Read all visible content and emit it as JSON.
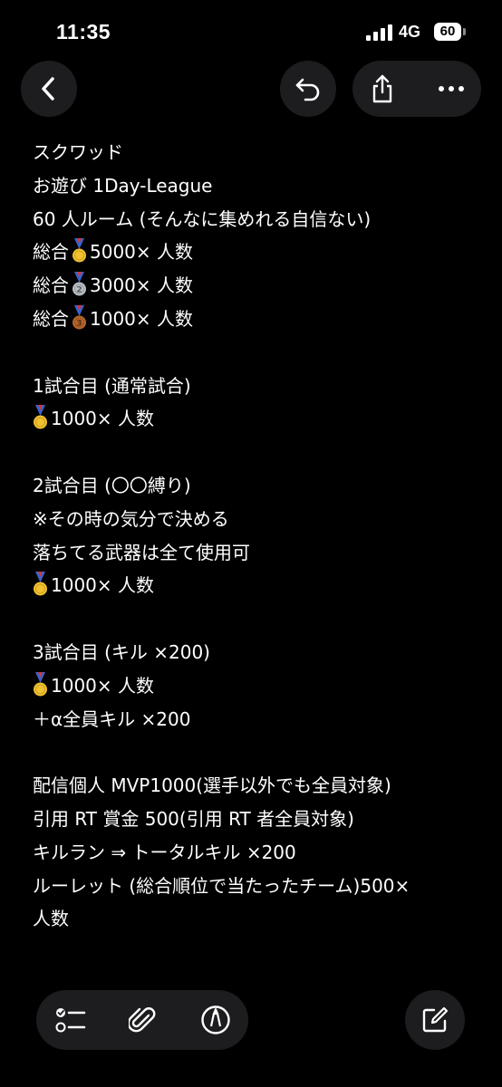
{
  "status_bar": {
    "time": "11:35",
    "network": "4G",
    "battery": "60"
  },
  "nav": {
    "back_icon": "chevron-left-icon",
    "undo_icon": "undo-icon",
    "share_icon": "share-icon",
    "more_icon": "ellipsis-icon"
  },
  "note": {
    "lines": [
      {
        "text": "スクワッド"
      },
      {
        "text": "お遊び 1Day-League"
      },
      {
        "text": "60 人ルーム (そんなに集めれる自信ない)"
      },
      {
        "text": "5000× 人数",
        "prefix": "総合",
        "medal": "gold-medal-icon"
      },
      {
        "text": "3000× 人数",
        "prefix": "総合",
        "medal": "silver-medal-icon"
      },
      {
        "text": "1000× 人数",
        "prefix": "総合",
        "medal": "bronze-medal-icon"
      },
      {
        "text": ""
      },
      {
        "text": "1試合目 (通常試合)"
      },
      {
        "text": "1000× 人数",
        "medal": "gold-medal-icon"
      },
      {
        "text": ""
      },
      {
        "text": "2試合目 (〇〇縛り)"
      },
      {
        "text": "※その時の気分で決める"
      },
      {
        "text": "落ちてる武器は全て使用可"
      },
      {
        "text": "1000× 人数",
        "medal": "gold-medal-icon"
      },
      {
        "text": ""
      },
      {
        "text": "3試合目 (キル ×200)"
      },
      {
        "text": "1000× 人数",
        "medal": "gold-medal-icon"
      },
      {
        "text": "＋α全員キル ×200"
      },
      {
        "text": ""
      },
      {
        "text": "配信個人 MVP1000(選手以外でも全員対象)"
      },
      {
        "text": "引用 RT 賞金 500(引用 RT 者全員対象)"
      },
      {
        "text": "キルラン ⇒ トータルキル ×200"
      },
      {
        "text": "ルーレット (総合順位で当たったチーム)500×"
      },
      {
        "text": "人数"
      }
    ]
  },
  "toolbar": {
    "checklist_icon": "checklist-icon",
    "attachment_icon": "paperclip-icon",
    "markup_icon": "markup-pen-icon",
    "compose_icon": "compose-icon"
  },
  "colors": {
    "background": "#000000",
    "button_bg": "#1d1d1f",
    "text": "#ffffff",
    "gold": "#f2c12e",
    "silver": "#b9bec4",
    "bronze": "#b8652a",
    "ribbon_blue": "#3a63c8",
    "ribbon_red": "#d6343b"
  }
}
